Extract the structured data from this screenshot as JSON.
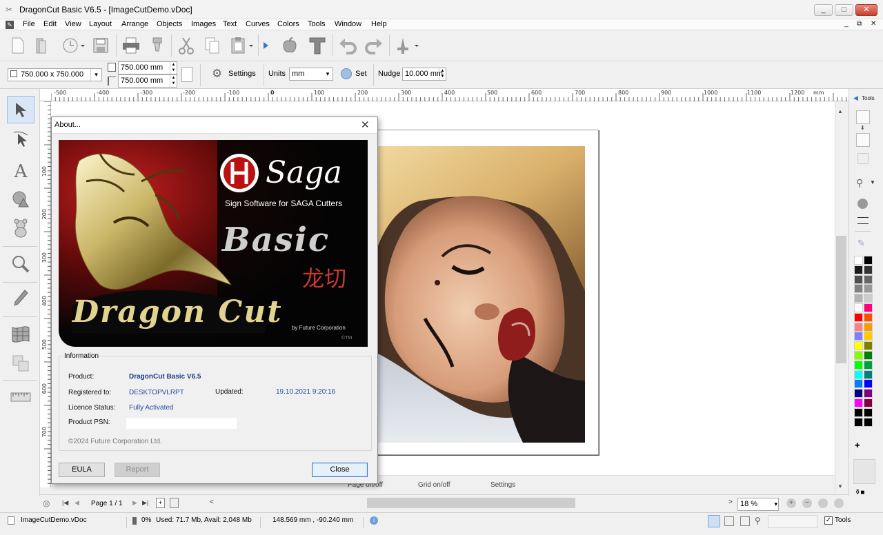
{
  "window": {
    "title": "DragonCut Basic V6.5 - [ImageCutDemo.vDoc]",
    "controls": [
      "_",
      "□",
      "✕"
    ]
  },
  "menu": {
    "items": [
      "File",
      "Edit",
      "View",
      "Layout",
      "Arrange",
      "Objects",
      "Images",
      "Text",
      "Curves",
      "Colors",
      "Tools",
      "Window",
      "Help"
    ],
    "doc_controls": [
      "_",
      "⧉",
      "✕"
    ]
  },
  "toolbar2": {
    "page_size": "750.000 x 750.000",
    "width_value": "750.000 mm",
    "height_value": "750.000 mm",
    "settings_label": "Settings",
    "units_label": "Units",
    "units_value": "mm",
    "set_label": "Set",
    "nudge_label": "Nudge",
    "nudge_value": "10.000 mm"
  },
  "ruler": {
    "h_labels": [
      "-500",
      "-400",
      "-300",
      "-200",
      "-100",
      "0",
      "100",
      "200",
      "300",
      "400",
      "500",
      "600",
      "700",
      "800",
      "900",
      "1000",
      "1100",
      "1200"
    ],
    "h_unit": "mm",
    "v_labels": [
      "100",
      "200",
      "300",
      "400",
      "500",
      "600",
      "700"
    ]
  },
  "right_panel": {
    "tab_label": "Tools",
    "colors": [
      "#ffffff",
      "#000000",
      "#1a1a1a",
      "#333333",
      "#4d4d4d",
      "#666666",
      "#808080",
      "#999999",
      "#b3b3b3",
      "#cccccc",
      "#ffffff",
      "#ff0080",
      "#ff0000",
      "#ff5000",
      "#ff8080",
      "#ff9900",
      "#8080ff",
      "#ffcc00",
      "#ffff00",
      "#808000",
      "#80ff00",
      "#008000",
      "#00ff00",
      "#00a040",
      "#00ffff",
      "#008080",
      "#0080ff",
      "#0000ff",
      "#000080",
      "#800080",
      "#ff00ff",
      "#800040",
      "#000000",
      "#000000",
      "#000000",
      "#000000"
    ]
  },
  "canvas_footer": {
    "page_onoff": "Page on/off",
    "grid_onoff": "Grid on/off",
    "settings": "Settings"
  },
  "navbar": {
    "page_label": "Page 1 / 1",
    "zoom_value": "18 %"
  },
  "statusbar": {
    "filename": "ImageCutDemo.vDoc",
    "progress": "0%",
    "memory": "Used: 71.7 Mb, Avail: 2,048 Mb",
    "coords": "148.569 mm , -90.240 mm",
    "tools_label": "Tools"
  },
  "about": {
    "title": "About...",
    "banner": {
      "brand": "Saga",
      "subtitle": "Sign Software for SAGA Cutters",
      "product_word": "Basic",
      "chinese": "龙切",
      "logo_text": "Dragon Cut",
      "company": "by Future Corporation",
      "tm": "©TM"
    },
    "info_heading": "Information",
    "product_label": "Product:",
    "product_value": "DragonCut Basic V6.5",
    "registered_label": "Registered to:",
    "registered_value": "DESKTOPVLRPT",
    "updated_label": "Updated:",
    "updated_value": "19.10.2021 9:20:16",
    "licence_label": "Licence Status:",
    "licence_value": "Fully Activated",
    "psn_label": "Product PSN:",
    "psn_value": "",
    "copyright": "©2024 Future Corporation Ltd.",
    "eula_button": "EULA",
    "report_button": "Report",
    "close_button": "Close"
  }
}
